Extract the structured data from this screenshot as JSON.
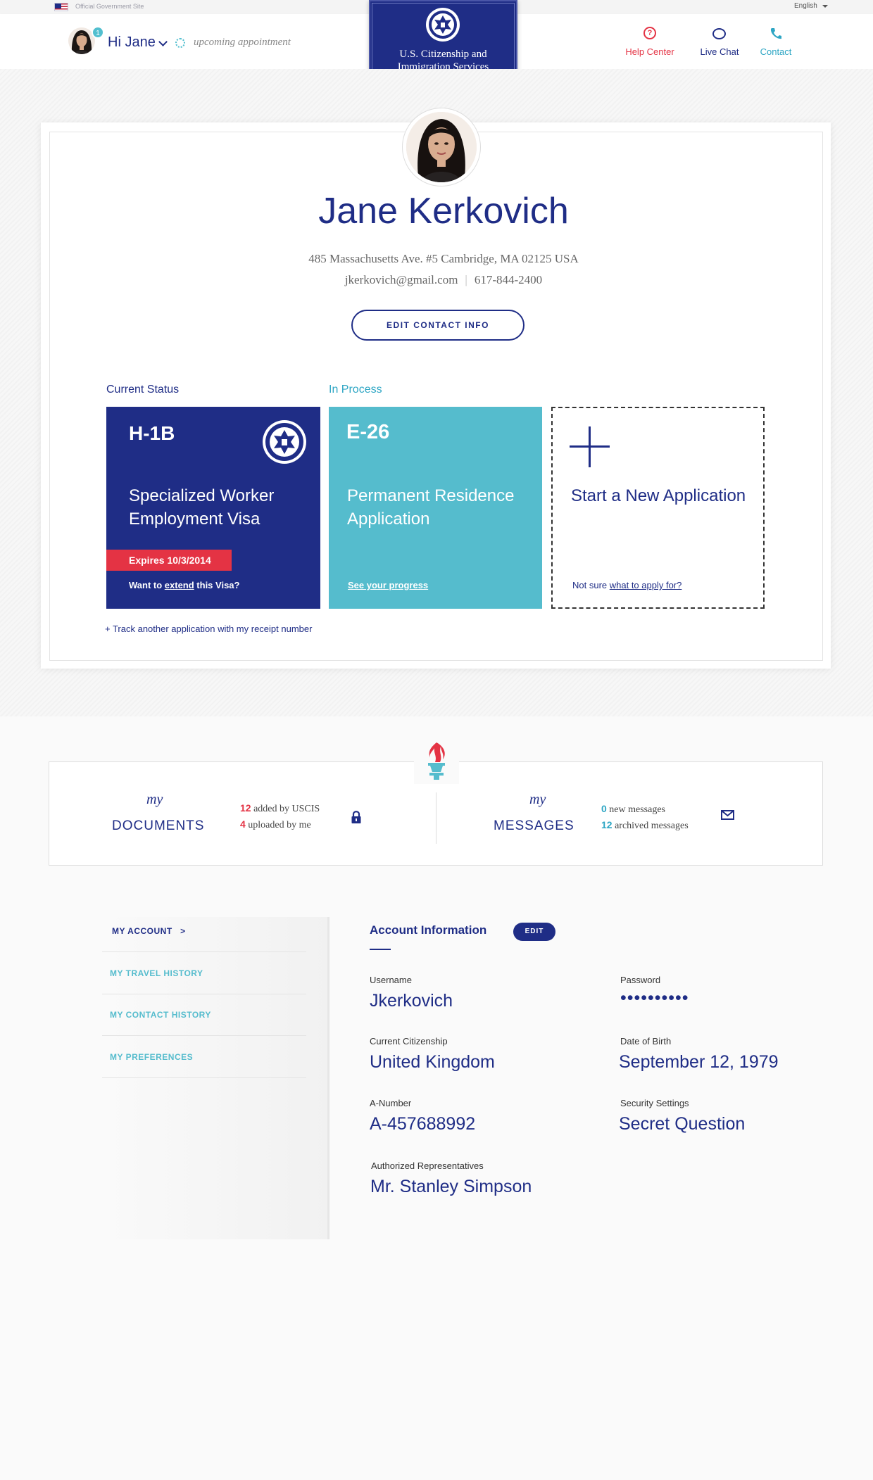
{
  "govbar": {
    "label": "Official Government Site",
    "language": "English"
  },
  "header": {
    "notification_count": "1",
    "greeting": "Hi Jane",
    "upcoming": "upcoming appointment",
    "agency_line1": "U.S. Citizenship and",
    "agency_line2": "Immigration Services",
    "nav": {
      "help": "Help Center",
      "chat": "Live Chat",
      "contact": "Contact"
    },
    "colors": {
      "brand": "#1f2d86",
      "accent": "#55bccd",
      "alert": "#e43344"
    }
  },
  "profile": {
    "name": "Jane Kerkovich",
    "address": "485 Massachusetts Ave. #5 Cambridge, MA 02125 USA",
    "email": "jkerkovich@gmail.com",
    "phone": "617-844-2400",
    "edit_button": "EDIT CONTACT INFO"
  },
  "status": {
    "current_label": "Current Status",
    "in_process_label": "In Process",
    "h1b": {
      "code": "H-1B",
      "title": "Specialized Worker Employment Visa",
      "expires": "Expires 10/3/2014",
      "extend_pre": "Want to ",
      "extend_link": "extend",
      "extend_post": " this Visa?"
    },
    "e26": {
      "code": "E-26",
      "title": "Permanent Residence Application",
      "link": "See your progress"
    },
    "new_app": {
      "title": "Start a New Application",
      "notsure_pre": "Not sure ",
      "notsure_link": "what to apply for?"
    },
    "track_link": "+ Track another application with my receipt number"
  },
  "documents": {
    "script": "my",
    "label": "DOCUMENTS",
    "added_count": "12",
    "added_text": " added by USCIS",
    "uploaded_count": "4",
    "uploaded_text": " uploaded by me"
  },
  "messages": {
    "script": "my",
    "label": "MESSAGES",
    "new_count": "0",
    "new_text": " new messages",
    "archived_count": "12",
    "archived_text": " archived messages"
  },
  "sidebar": {
    "items": [
      {
        "label": "MY ACCOUNT   >"
      },
      {
        "label": "MY TRAVEL HISTORY"
      },
      {
        "label": "MY CONTACT HISTORY"
      },
      {
        "label": "MY PREFERENCES"
      }
    ]
  },
  "account": {
    "title": "Account Information",
    "edit": "EDIT",
    "fields": {
      "username_label": "Username",
      "username": "Jkerkovich",
      "password_label": "Password",
      "password": "••••••••••",
      "citizenship_label": "Current Citizenship",
      "citizenship": "United Kingdom",
      "dob_label": "Date of Birth",
      "dob": "September 12, 1979",
      "anumber_label": "A-Number",
      "anumber": "A-457688992",
      "security_label": "Security Settings",
      "security": "Secret Question",
      "reps_label": "Authorized Representatives",
      "reps": "Mr. Stanley Simpson"
    }
  }
}
